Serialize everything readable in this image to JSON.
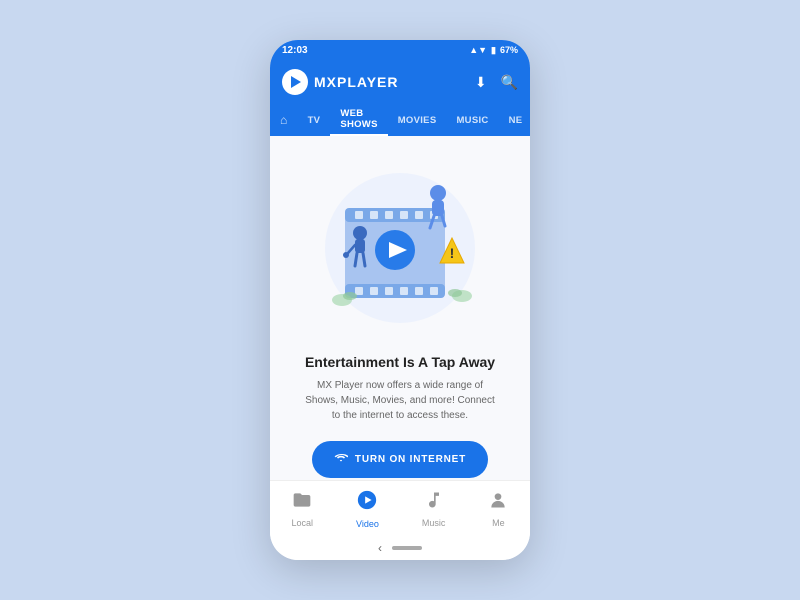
{
  "app": {
    "name": "MXPLAYER",
    "logo_alt": "MX Player Logo"
  },
  "status_bar": {
    "time": "12:03",
    "battery": "67%",
    "signal_icon": "▲",
    "wifi_icon": "▼"
  },
  "header": {
    "download_icon": "⬇",
    "search_icon": "🔍"
  },
  "nav_tabs": [
    {
      "label": "⌂",
      "id": "home",
      "active": false
    },
    {
      "label": "TV",
      "id": "tv",
      "active": false
    },
    {
      "label": "WEB SHOWS",
      "id": "web-shows",
      "active": true
    },
    {
      "label": "MOVIES",
      "id": "movies",
      "active": false
    },
    {
      "label": "MUSIC",
      "id": "music",
      "active": false
    },
    {
      "label": "NE",
      "id": "news",
      "active": false
    }
  ],
  "main": {
    "title": "Entertainment Is A Tap Away",
    "description": "MX Player now offers a wide range of Shows, Music, Movies, and more! Connect to the internet to access these.",
    "button_label": "TURN ON INTERNET"
  },
  "bottom_nav": [
    {
      "label": "Local",
      "icon": "folder",
      "active": false
    },
    {
      "label": "Video",
      "icon": "play",
      "active": true
    },
    {
      "label": "Music",
      "icon": "music",
      "active": false
    },
    {
      "label": "Me",
      "icon": "user",
      "active": false
    }
  ],
  "colors": {
    "primary": "#1a73e8",
    "background": "#c8d8f0",
    "content_bg": "#f8f9fc"
  }
}
